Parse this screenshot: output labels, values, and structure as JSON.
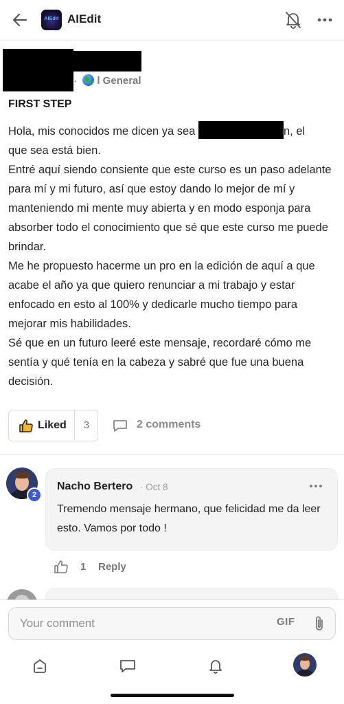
{
  "header": {
    "app_logo_text": "AIEdit",
    "title": "AIEdit",
    "icons": {
      "back": "back-arrow-icon",
      "notifications": "bell-off-icon",
      "more": "more-horizontal-icon"
    }
  },
  "post": {
    "meta_separator": "·",
    "category": "l General",
    "title": "FIRST STEP",
    "body": {
      "line1_before": "Hola, mis conocidos me dicen ya sea",
      "line1_after": "n, el",
      "rest": "que sea está bien.",
      "paragraphs": [
        "Entré aquí siendo consiente que este curso es un paso adelante para mí y mi futuro, así que estoy dando lo mejor de mí y manteniendo mi mente muy abierta y en modo esponja para absorber todo el conocimiento que sé que este curso me puede brindar.",
        "Me he propuesto hacerme un pro en la edición de aquí a que acabe el año ya que quiero renunciar a mi trabajo y estar enfocado en esto al 100% y dedicarle mucho tiempo para mejorar mis habilidades.",
        "Sé que en un futuro leeré este mensaje, recordaré cómo me sentía y qué tenía en la cabeza y sabré que fue una buena decisión."
      ]
    },
    "like_label": "Liked",
    "like_count": "3",
    "comments_label": "2 comments"
  },
  "comments": [
    {
      "author": "Nacho Bertero",
      "date": "· Oct 8",
      "level": "2",
      "text": "Tremendo mensaje hermano, que felicidad me da leer esto. Vamos por todo !",
      "like_count": "1",
      "reply_label": "Reply"
    }
  ],
  "composer": {
    "placeholder": "Your comment",
    "gif_label": "GIF"
  },
  "nav": {
    "items": [
      "home-icon",
      "chat-icon",
      "notifications-bell-icon",
      "profile-avatar"
    ]
  },
  "colors": {
    "accent_blue": "#3b5ad1",
    "comment_bg": "#f4f4f4",
    "text": "#222222",
    "muted": "#8a8a8a"
  }
}
